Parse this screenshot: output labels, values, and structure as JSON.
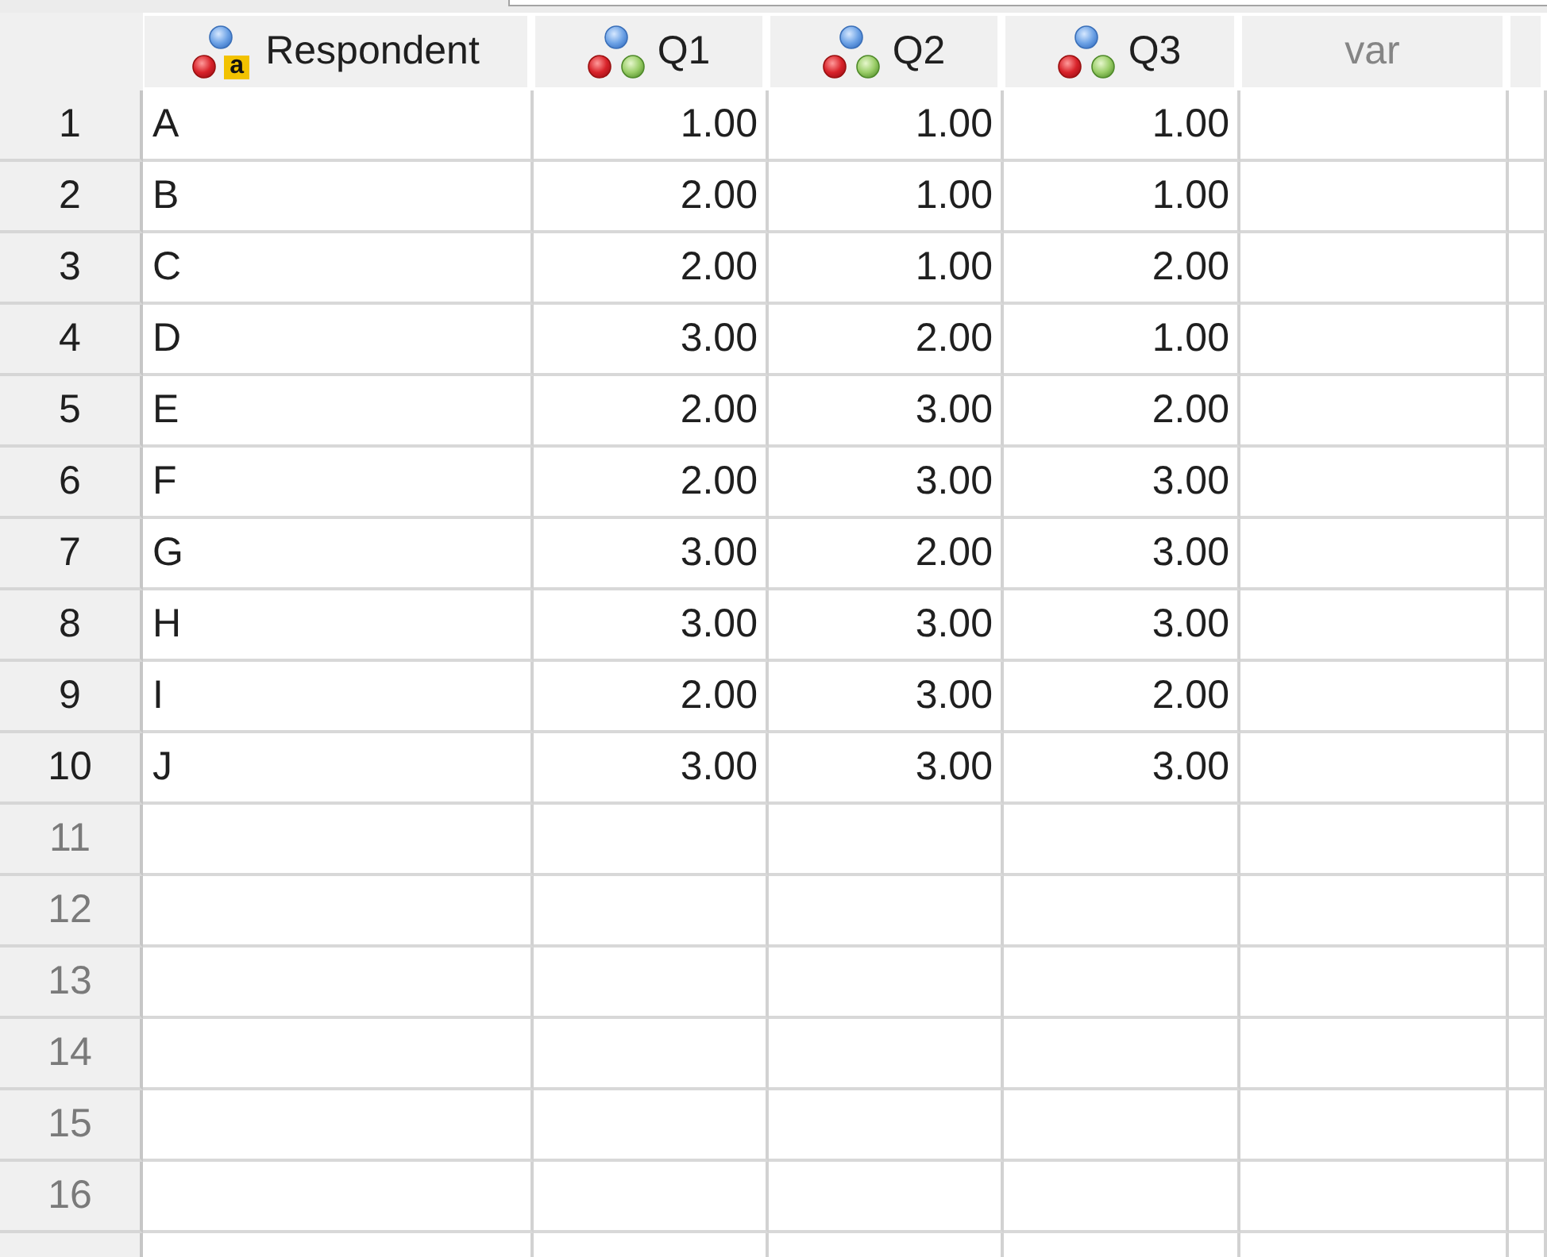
{
  "data_view": {
    "columns": [
      {
        "name": "Respondent",
        "kind": "string",
        "badge": "a"
      },
      {
        "name": "Q1",
        "kind": "nominal"
      },
      {
        "name": "Q2",
        "kind": "nominal"
      },
      {
        "name": "Q3",
        "kind": "nominal"
      },
      {
        "name": "var",
        "kind": "unused"
      }
    ],
    "rows": [
      {
        "number": "1",
        "filled": true,
        "cells": [
          "A",
          "1.00",
          "1.00",
          "1.00"
        ]
      },
      {
        "number": "2",
        "filled": true,
        "cells": [
          "B",
          "2.00",
          "1.00",
          "1.00"
        ]
      },
      {
        "number": "3",
        "filled": true,
        "cells": [
          "C",
          "2.00",
          "1.00",
          "2.00"
        ]
      },
      {
        "number": "4",
        "filled": true,
        "cells": [
          "D",
          "3.00",
          "2.00",
          "1.00"
        ]
      },
      {
        "number": "5",
        "filled": true,
        "cells": [
          "E",
          "2.00",
          "3.00",
          "2.00"
        ]
      },
      {
        "number": "6",
        "filled": true,
        "cells": [
          "F",
          "2.00",
          "3.00",
          "3.00"
        ]
      },
      {
        "number": "7",
        "filled": true,
        "cells": [
          "G",
          "3.00",
          "2.00",
          "3.00"
        ]
      },
      {
        "number": "8",
        "filled": true,
        "cells": [
          "H",
          "3.00",
          "3.00",
          "3.00"
        ]
      },
      {
        "number": "9",
        "filled": true,
        "cells": [
          "I",
          "2.00",
          "3.00",
          "2.00"
        ]
      },
      {
        "number": "10",
        "filled": true,
        "cells": [
          "J",
          "3.00",
          "3.00",
          "3.00"
        ]
      },
      {
        "number": "11",
        "filled": false
      },
      {
        "number": "12",
        "filled": false
      },
      {
        "number": "13",
        "filled": false
      },
      {
        "number": "14",
        "filled": false
      },
      {
        "number": "15",
        "filled": false
      },
      {
        "number": "16",
        "filled": false
      }
    ]
  }
}
